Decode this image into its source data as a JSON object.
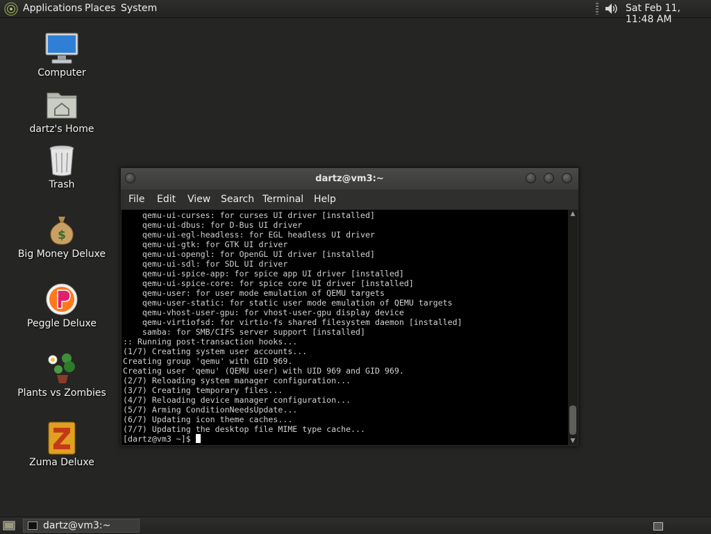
{
  "top_panel": {
    "menus": [
      "Applications",
      "Places",
      "System"
    ],
    "clock": "Sat Feb 11, 11:48 AM",
    "distro_icon": "gnome-foot-icon",
    "volume_icon": "speaker-icon"
  },
  "desktop": {
    "icons": [
      {
        "label": "Computer",
        "icon": "computer-icon"
      },
      {
        "label": "dartz's Home",
        "icon": "home-folder-icon"
      },
      {
        "label": "Trash",
        "icon": "trash-icon"
      },
      {
        "label": "Big Money Deluxe",
        "icon": "money-bag-icon"
      },
      {
        "label": "Peggle Deluxe",
        "icon": "peggle-icon"
      },
      {
        "label": "Plants vs Zombies",
        "icon": "plants-vs-zombies-icon"
      },
      {
        "label": "Zuma Deluxe",
        "icon": "zuma-icon"
      }
    ]
  },
  "terminal": {
    "title": "dartz@vm3:~",
    "menu": [
      "File",
      "Edit",
      "View",
      "Search",
      "Terminal",
      "Help"
    ],
    "lines": [
      "    qemu-ui-curses: for curses UI driver [installed]",
      "    qemu-ui-dbus: for D-Bus UI driver",
      "    qemu-ui-egl-headless: for EGL headless UI driver",
      "    qemu-ui-gtk: for GTK UI driver",
      "    qemu-ui-opengl: for OpenGL UI driver [installed]",
      "    qemu-ui-sdl: for SDL UI driver",
      "    qemu-ui-spice-app: for spice app UI driver [installed]",
      "    qemu-ui-spice-core: for spice core UI driver [installed]",
      "    qemu-user: for user mode emulation of QEMU targets",
      "    qemu-user-static: for static user mode emulation of QEMU targets",
      "    qemu-vhost-user-gpu: for vhost-user-gpu display device",
      "    qemu-virtiofsd: for virtio-fs shared filesystem daemon [installed]",
      "    samba: for SMB/CIFS server support [installed]",
      ":: Running post-transaction hooks...",
      "(1/7) Creating system user accounts...",
      "Creating group 'qemu' with GID 969.",
      "Creating user 'qemu' (QEMU user) with UID 969 and GID 969.",
      "(2/7) Reloading system manager configuration...",
      "(3/7) Creating temporary files...",
      "(4/7) Reloading device manager configuration...",
      "(5/7) Arming ConditionNeedsUpdate...",
      "(6/7) Updating icon theme caches...",
      "(7/7) Updating the desktop file MIME type cache..."
    ],
    "prompt": "[dartz@vm3 ~]$ "
  },
  "taskbar": {
    "task_label": "dartz@vm3:~",
    "show_desktop_icon": "show-desktop-icon",
    "workspace_icon": "workspace-switcher-icon"
  }
}
